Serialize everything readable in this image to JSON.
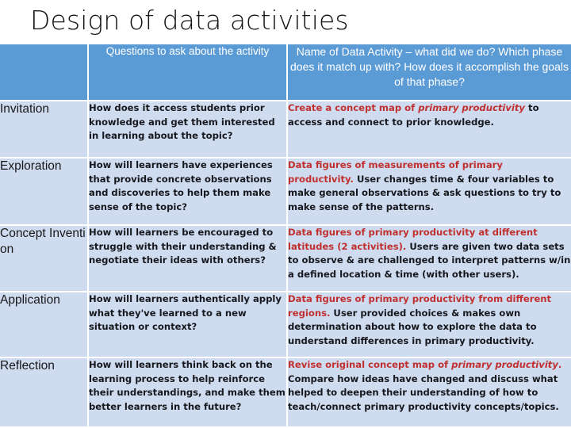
{
  "slide": {
    "title": "Design of data activities",
    "colors": {
      "header_bg": "#5B9BD5",
      "cell_bg": "#CFDBEF",
      "gridline": "#FFFFFF",
      "accent_red": "#C0302F",
      "body_text": "#16181D",
      "title_text": "#141414",
      "header_text": "#FFFFFF"
    }
  },
  "table": {
    "headers": {
      "phase": "",
      "questions": "Questions to ask about the activity",
      "name": "Name of Data Activity – what did we do? Which phase does it match up with? How does it accomplish the goals of that phase?"
    },
    "rows": [
      {
        "phase": "Invitation",
        "question": "How does it access students prior knowledge and get them interested in learning about the topic?",
        "activity_lead": "Create a concept map of ",
        "activity_lead_italic": "primary productivity",
        "activity_lead_tail": "",
        "activity_body": " to access and connect to prior knowledge."
      },
      {
        "phase": "Exploration",
        "question": "How will learners have experiences that provide concrete observations and discoveries to help them make sense of the topic?",
        "activity_lead": "Data figures of measurements of primary productivity.",
        "activity_lead_italic": "",
        "activity_lead_tail": "",
        "activity_body": " User changes time & four variables to make general observations & ask questions to try to make sense of the patterns."
      },
      {
        "phase": "Concept Invention",
        "question": "How will learners be encouraged to struggle with their understanding & negotiate their ideas with others?",
        "activity_lead": "Data figures of primary productivity at different latitudes (2 activities).",
        "activity_lead_italic": "",
        "activity_lead_tail": "",
        "activity_body": " Users are given two data sets to observe & are challenged to interpret patterns w/in a defined location & time (with other users)."
      },
      {
        "phase": "Application",
        "question": "How will learners authentically apply what they've learned to a new situation or context?",
        "activity_lead": "Data figures of primary productivity from different regions.",
        "activity_lead_italic": "",
        "activity_lead_tail": "",
        "activity_body": " User provided choices & makes own determination about how to explore the data to understand differences in primary productivity."
      },
      {
        "phase": "Reflection",
        "question": "How will learners think back on the learning process to help reinforce their understandings, and make them better learners in the future?",
        "activity_lead": "Revise original concept map of ",
        "activity_lead_italic": "primary productivity",
        "activity_lead_tail": ".",
        "activity_body": " Compare how ideas have changed and discuss what helped to deepen their understanding of how to teach/connect primary productivity concepts/topics."
      }
    ]
  }
}
